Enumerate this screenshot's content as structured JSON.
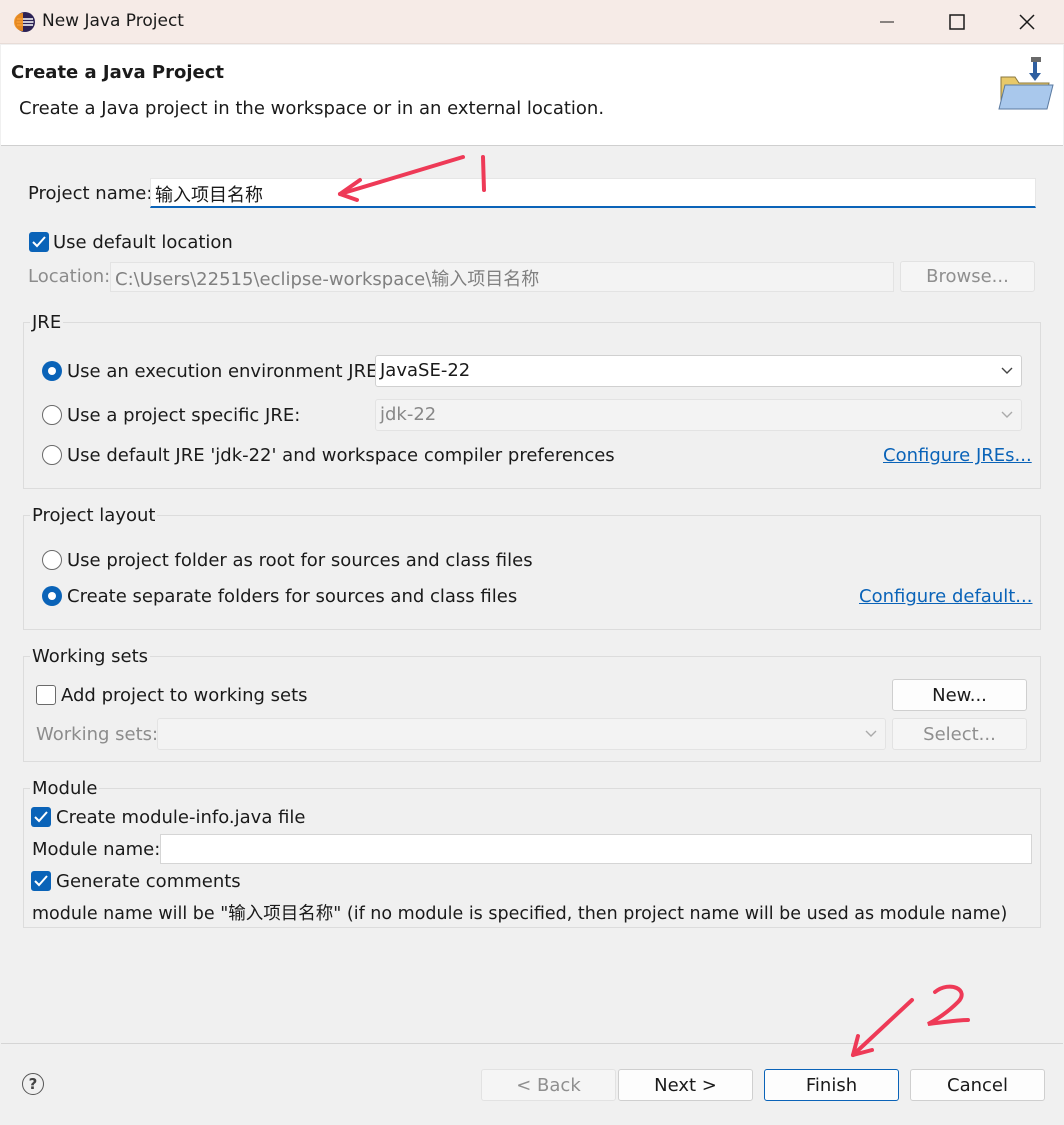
{
  "window": {
    "title": "New Java Project"
  },
  "banner": {
    "heading": "Create a Java Project",
    "description": "Create a Java project in the workspace or in an external location."
  },
  "project": {
    "name_label": "Project name:",
    "name_value": "输入项目名称",
    "use_default_location_label": "Use default location",
    "use_default_location_checked": true,
    "location_label": "Location:",
    "location_value": "C:\\Users\\22515\\eclipse-workspace\\输入项目名称",
    "browse_label": "Browse..."
  },
  "jre": {
    "group_title": "JRE",
    "option_execution_env": "Use an execution environment JRE:",
    "execution_env_value": "JavaSE-22",
    "option_project_specific": "Use a project specific JRE:",
    "project_specific_value": "jdk-22",
    "option_default_jre": "Use default JRE 'jdk-22' and workspace compiler preferences",
    "configure_link": "Configure JREs...",
    "selected": "execution_env"
  },
  "layout": {
    "group_title": "Project layout",
    "option_root": "Use project folder as root for sources and class files",
    "option_separate": "Create separate folders for sources and class files",
    "configure_link": "Configure default...",
    "selected": "separate"
  },
  "working_sets": {
    "group_title": "Working sets",
    "add_label": "Add project to working sets",
    "add_checked": false,
    "new_button": "New...",
    "sets_label": "Working sets:",
    "select_button": "Select..."
  },
  "module": {
    "group_title": "Module",
    "create_label": "Create module-info.java file",
    "create_checked": true,
    "name_label": "Module name:",
    "name_value": "",
    "generate_label": "Generate comments",
    "generate_checked": true,
    "note": "module name will be \"输入项目名称\"  (if no module is specified, then project name will be used as module name)"
  },
  "footer": {
    "back_button": "< Back",
    "next_button": "Next >",
    "finish_button": "Finish",
    "cancel_button": "Cancel"
  },
  "annotations": {
    "marker_1": "1",
    "marker_2": "2",
    "color": "#ee3a57"
  }
}
